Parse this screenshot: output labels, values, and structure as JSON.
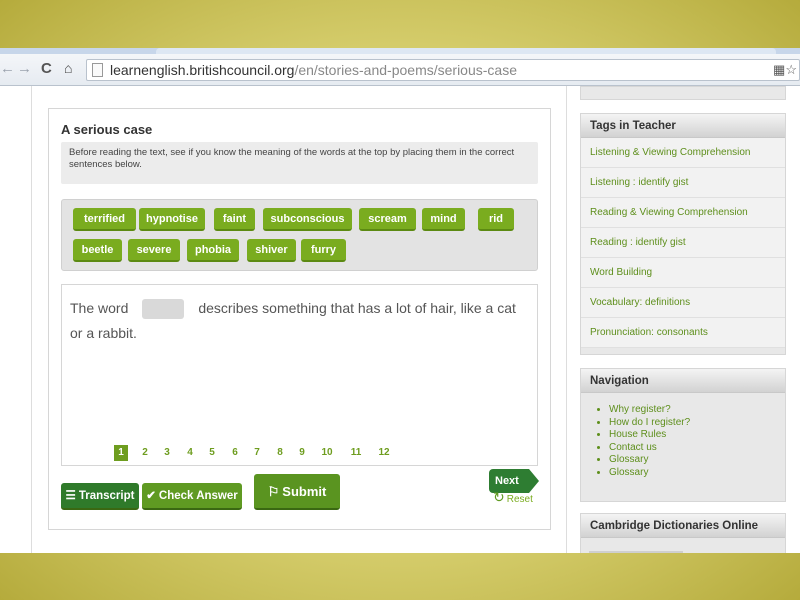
{
  "browser": {
    "url_host": "learnenglish.britishcouncil.org",
    "url_path": "/en/stories-and-poems/serious-case",
    "nav_icons": [
      "back-icon",
      "forward-icon",
      "reload-icon",
      "home-icon",
      "page-icon",
      "extension-icon",
      "star-icon"
    ]
  },
  "card": {
    "title": "A serious case",
    "instructions": "Before reading the text, see if you know the meaning of the words at the top by placing them in the correct sentences below."
  },
  "wordbank": {
    "words": [
      "terrified",
      "hypnotise",
      "faint",
      "subconscious",
      "scream",
      "mind",
      "rid",
      "beetle",
      "severe",
      "phobia",
      "shiver",
      "furry"
    ]
  },
  "exercise": {
    "sentence_before": "The word",
    "sentence_after": "describes something that has a lot of hair, like a cat or a rabbit."
  },
  "pager": {
    "pages": [
      "1",
      "2",
      "3",
      "4",
      "5",
      "6",
      "7",
      "8",
      "9",
      "10",
      "11",
      "12"
    ],
    "current": "1"
  },
  "buttons": {
    "transcript": "Transcript",
    "check": "Check Answer",
    "submit": "Submit",
    "next": "Next",
    "reset": "Reset"
  },
  "sidebar": {
    "tags_title": "Tags in Teacher",
    "tags": [
      "Listening & Viewing Comprehension",
      "Listening : identify gist",
      "Reading & Viewing Comprehension",
      "Reading : identify gist",
      "Word Building",
      "Vocabulary: definitions",
      "Pronunciation: consonants"
    ],
    "nav_title": "Navigation",
    "nav_items": [
      "Why register?",
      "How do I register?",
      "House Rules",
      "Contact us",
      "Glossary",
      "Glossary"
    ],
    "dict_title": "Cambridge Dictionaries Online"
  },
  "colors": {
    "chip_green": "#7aac1f",
    "button_green": "#4f8a1c",
    "link_green": "#5e8f1c",
    "slide_background": "#d8d070"
  }
}
